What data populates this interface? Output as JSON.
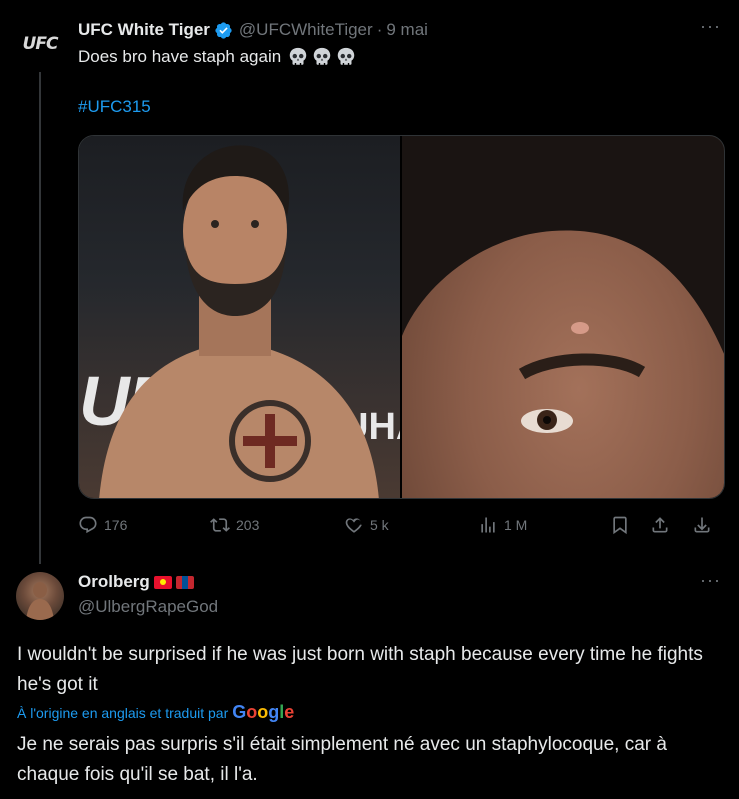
{
  "tweet": {
    "author_name": "UFC White Tiger",
    "author_handle": "@UFCWhiteTiger",
    "separator": "·",
    "date": "9 mai",
    "avatar_text": "UFC",
    "text": "Does bro have staph again",
    "emoji": [
      "skull-icon",
      "skull-icon",
      "skull-icon"
    ],
    "hashtag": "#UFC315",
    "media_text_left": "UFC",
    "media_text_right": "UHA",
    "stats": {
      "replies": "176",
      "retweets": "203",
      "likes": "5 k",
      "views": "1 M"
    },
    "more_label": "···"
  },
  "reply": {
    "author_name": "Orolberg",
    "flags": [
      "kyrgyzstan-flag",
      "mongolia-flag"
    ],
    "author_handle": "@UlbergRapeGod",
    "more_label": "···",
    "text": "I wouldn't be surprised if he was just born with staph because every time he fights he's got it",
    "translation_note": "À l'origine en anglais et traduit par",
    "translation_provider": "Google",
    "translated_text": "Je ne serais pas surpris s'il était simplement né avec un staphylocoque, car à chaque fois qu'il se bat, il l'a."
  },
  "colors": {
    "background": "#000000",
    "text": "#e7e9ea",
    "muted": "#71767b",
    "link": "#1d9bf0",
    "verified": "#1d9bf0"
  }
}
